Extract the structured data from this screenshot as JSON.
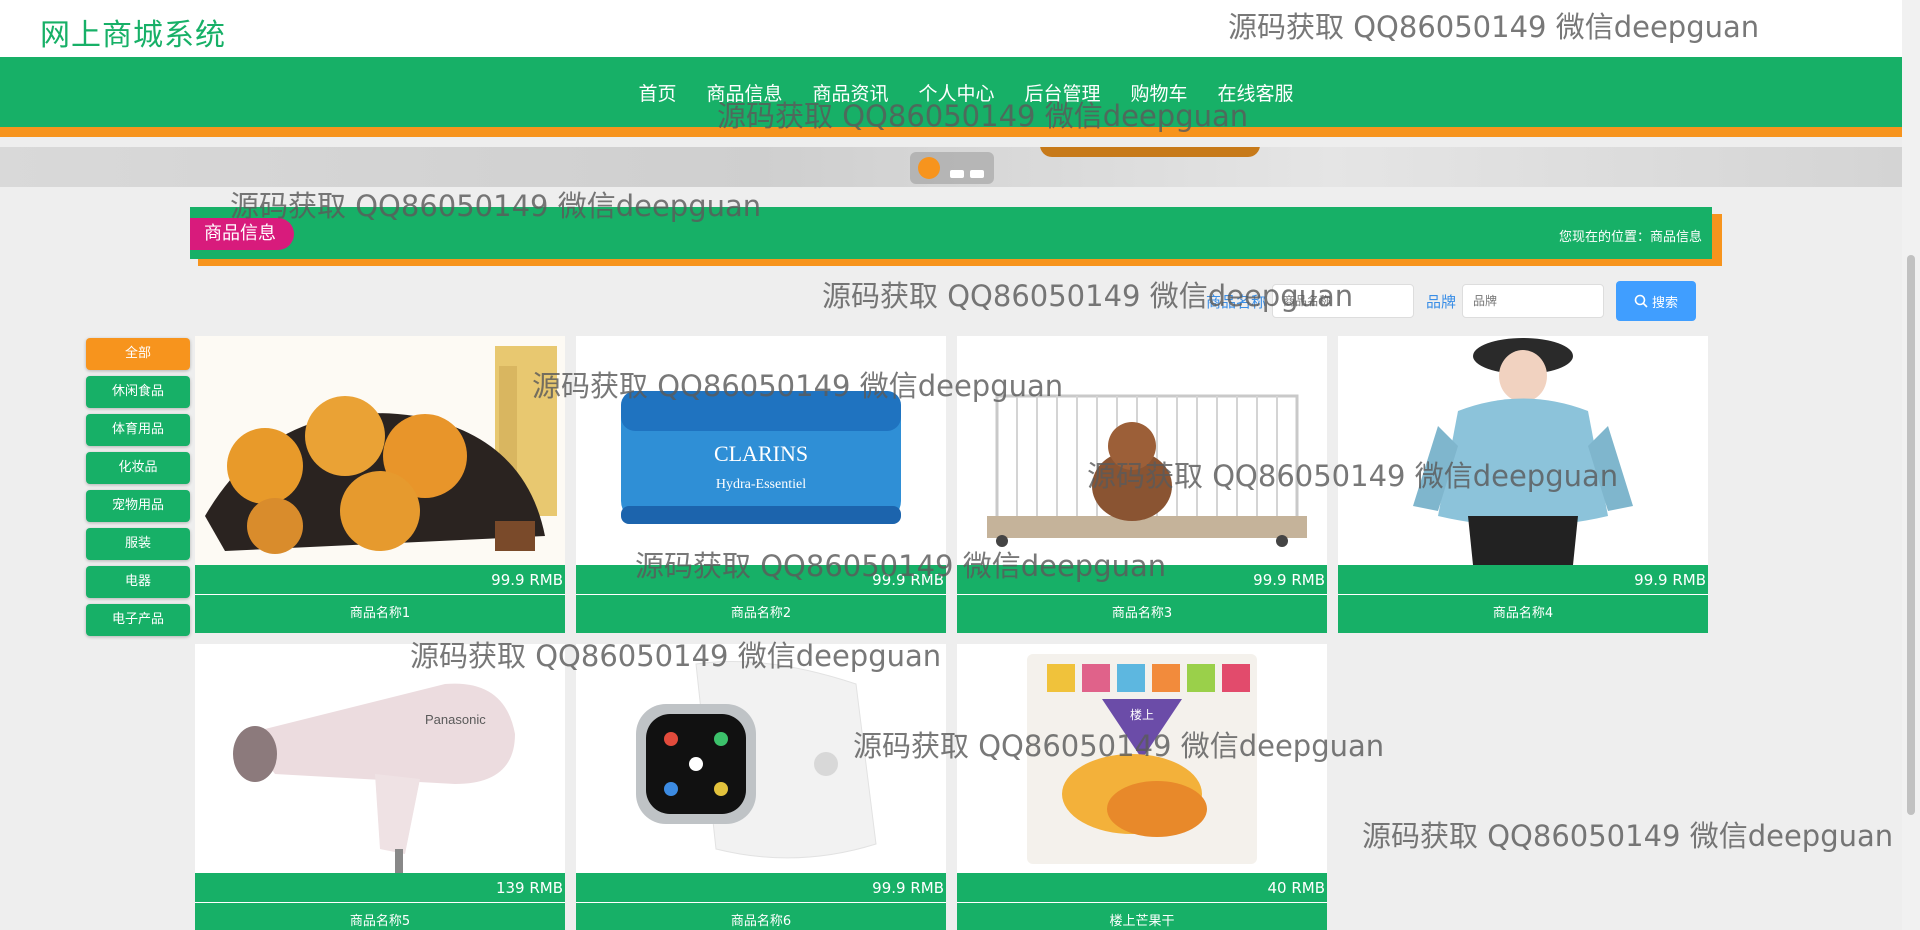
{
  "site": {
    "title": "网上商城系统"
  },
  "nav": [
    "首页",
    "商品信息",
    "商品资讯",
    "个人中心",
    "后台管理",
    "购物车",
    "在线客服"
  ],
  "section": {
    "title": "商品信息",
    "location": "您现在的位置：商品信息"
  },
  "search": {
    "name_label": "商品名称",
    "name_placeholder": "商品名称",
    "brand_label": "品牌",
    "brand_placeholder": "品牌",
    "button_label": "搜索"
  },
  "categories": [
    "全部",
    "休闲食品",
    "体育用品",
    "化妆品",
    "宠物用品",
    "服装",
    "电器",
    "电子产品"
  ],
  "products": [
    {
      "name": "商品名称1",
      "price": "99.9 RMB",
      "image": "pastry-icon"
    },
    {
      "name": "商品名称2",
      "price": "99.9 RMB",
      "image": "cream-jar-icon",
      "brand_text": "CLARINS",
      "sub_text": "Hydra-Essentiel"
    },
    {
      "name": "商品名称3",
      "price": "99.9 RMB",
      "image": "pet-cage-icon"
    },
    {
      "name": "商品名称4",
      "price": "99.9 RMB",
      "image": "hoodie-icon"
    },
    {
      "name": "商品名称5",
      "price": "139 RMB",
      "image": "hair-dryer-icon",
      "brand_text": "Panasonic"
    },
    {
      "name": "商品名称6",
      "price": "99.9 RMB",
      "image": "smartwatch-icon"
    },
    {
      "name": "楼上芒果干",
      "price": "40 RMB",
      "image": "snack-bag-icon",
      "brand_text": "楼上"
    }
  ],
  "watermark": "源码获取 QQ86050149 微信deepguan",
  "colors": {
    "primary": "#17b067",
    "accent": "#f7941d",
    "pill": "#d81b7c",
    "button": "#409eff"
  }
}
